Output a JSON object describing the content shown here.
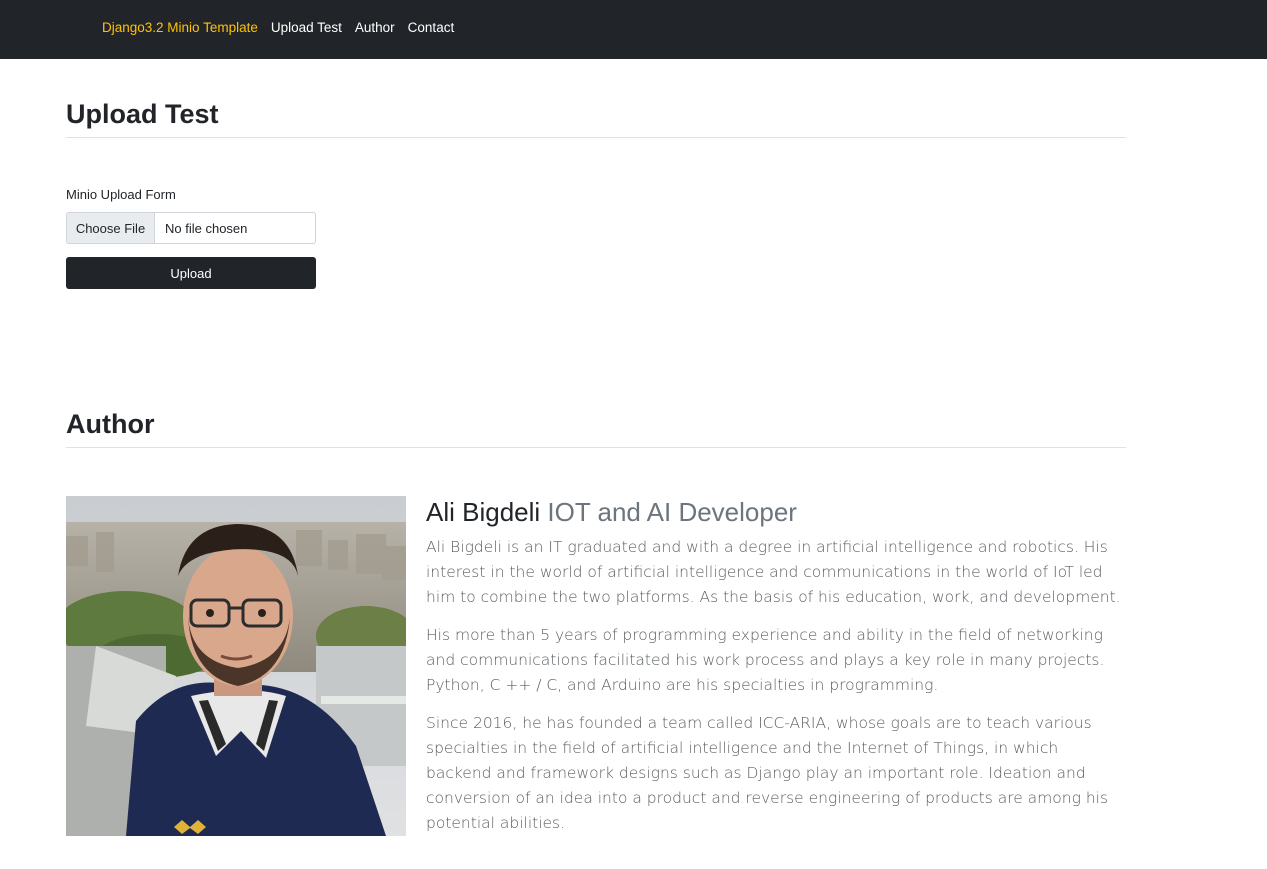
{
  "navbar": {
    "brand": "Django3.2 Minio Template",
    "links": [
      "Upload Test",
      "Author",
      "Contact"
    ]
  },
  "upload_section": {
    "title": "Upload Test",
    "form_label": "Minio Upload Form",
    "file_button": "Choose File",
    "file_status": "No file chosen",
    "submit_label": "Upload"
  },
  "author_section": {
    "title": "Author",
    "name": "Ali Bigdeli",
    "role": "IOT and AI Developer",
    "paragraphs": [
      "Ali Bigdeli is an IT graduated and with a degree in artificial intelligence and robotics. His interest in the world of artificial intelligence and communications in the world of IoT led him to combine the two platforms. As the basis of his education, work, and development.",
      "His more than 5 years of programming experience and ability in the field of networking and communications facilitated his work process and plays a key role in many projects. Python, C ++ / C, and Arduino are his specialties in programming.",
      "Since 2016, he has founded a team called ICC-ARIA, whose goals are to teach various specialties in the field of artificial intelligence and the Internet of Things, in which backend and framework designs such as Django play an important role. Ideation and conversion of an idea into a product and reverse engineering of products are among his potential abilities."
    ]
  },
  "colors": {
    "navbar_bg": "#212529",
    "brand": "#ffc107",
    "muted": "#6c757d"
  }
}
